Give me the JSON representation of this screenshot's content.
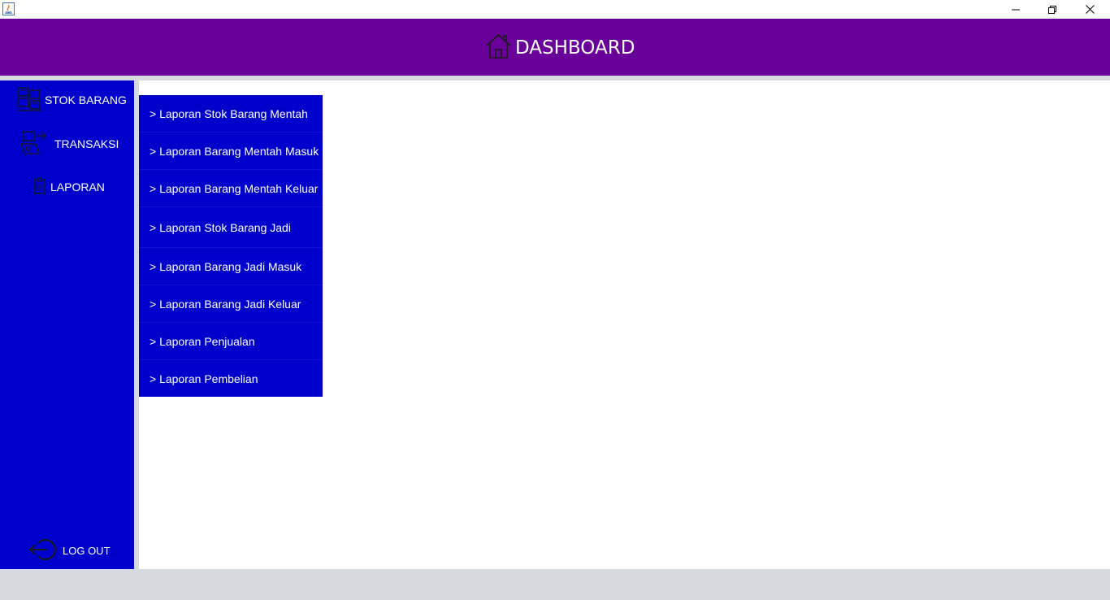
{
  "window": {
    "controls": {
      "minimize": "minimize-icon",
      "maximize": "restore-icon",
      "close": "close-icon"
    }
  },
  "header": {
    "title": "DASHBOARD",
    "icon": "home-icon"
  },
  "sidebar": {
    "items": [
      {
        "label": "STOK BARANG",
        "icon": "inventory-icon"
      },
      {
        "label": "TRANSAKSI",
        "icon": "transaction-icon"
      },
      {
        "label": "LAPORAN",
        "icon": "report-icon"
      }
    ],
    "logout": {
      "label": "LOG OUT",
      "icon": "logout-icon"
    }
  },
  "laporan_menu": {
    "items": [
      "> Laporan Stok Barang Mentah",
      "> Laporan Barang Mentah Masuk",
      "> Laporan Barang Mentah Keluar",
      "> Laporan Stok Barang Jadi",
      "> Laporan Barang Jadi Masuk",
      "> Laporan Barang Jadi Keluar",
      "> Laporan Penjualan",
      "> Laporan Pembelian"
    ]
  },
  "colors": {
    "header_bg": "#680099",
    "sidebar_bg": "#0000cc",
    "menu_bg": "#0000cc",
    "text": "#ffffff",
    "frame_bg": "#d6d9e0"
  }
}
